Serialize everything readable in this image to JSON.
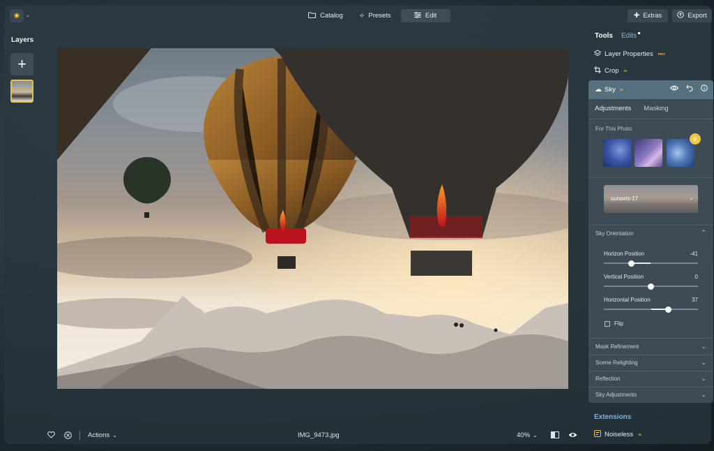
{
  "topbar": {
    "modes": [
      {
        "label": "Catalog",
        "icon": "folder-icon"
      },
      {
        "label": "Presets",
        "icon": "sparkle-icon"
      },
      {
        "label": "Edit",
        "icon": "sliders-icon",
        "active": true
      }
    ],
    "extras_label": "Extras",
    "export_label": "Export"
  },
  "layers": {
    "title": "Layers"
  },
  "photo": {
    "filename": "IMG_9473.jpg"
  },
  "panel": {
    "tab_tools": "Tools",
    "tab_edits": "Edits",
    "layer_properties": "Layer Properties",
    "layer_properties_badge": "PRO",
    "crop": "Crop",
    "crop_badge": "AI",
    "sky": {
      "title": "Sky",
      "badge": "AI",
      "subtabs": [
        "Adjustments",
        "Masking"
      ],
      "for_this_photo": "For This Photo",
      "selected_sky": "sunsets-17",
      "orientation_title": "Sky Orientation",
      "sliders": [
        {
          "label": "Horizon Position",
          "value": "-41",
          "level": -0.41
        },
        {
          "label": "Vertical Position",
          "value": "0",
          "level": 0
        },
        {
          "label": "Horizontal Position",
          "value": "37",
          "level": 0.37
        }
      ],
      "flip_label": "Flip",
      "sections": [
        "Mask Refinement",
        "Scene Relighting",
        "Reflection",
        "Sky Adjustments"
      ]
    },
    "extensions_title": "Extensions",
    "noiseless": "Noiseless",
    "noiseless_badge": "AI"
  },
  "bottom": {
    "actions_label": "Actions",
    "zoom": "40%"
  },
  "colors": {
    "accent": "#f2c230",
    "link": "#7fb2d9",
    "panel_header": "#56707f"
  }
}
